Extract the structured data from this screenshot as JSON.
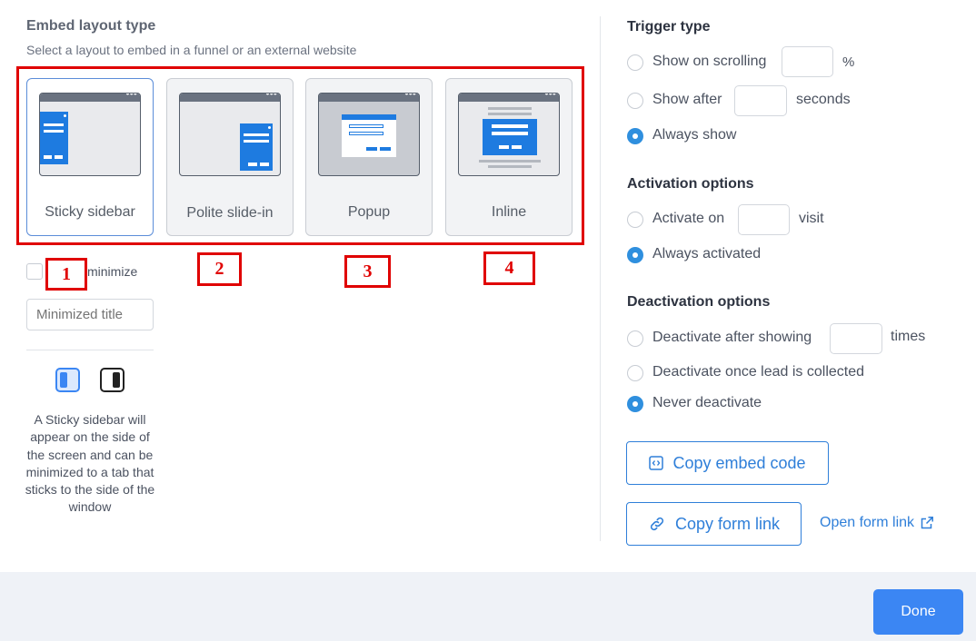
{
  "embed": {
    "title": "Embed layout type",
    "subtitle": "Select a layout to embed in a funnel or an external website",
    "layouts": [
      {
        "label": "Sticky sidebar"
      },
      {
        "label": "Polite slide-in"
      },
      {
        "label": "Popup"
      },
      {
        "label": "Inline"
      }
    ],
    "minimize_label": "minimize",
    "minimized_title_placeholder": "Minimized title",
    "description": "A Sticky sidebar will appear on the side of the screen and can be minimized to a tab that sticks to the side of the window"
  },
  "annotations": [
    "1",
    "2",
    "3",
    "4"
  ],
  "trigger": {
    "title": "Trigger type",
    "scrolling_label": "Show on scrolling",
    "scrolling_unit": "%",
    "after_label": "Show after",
    "after_unit": "seconds",
    "always_label": "Always show"
  },
  "activation": {
    "title": "Activation options",
    "activate_on_label": "Activate on",
    "activate_on_unit": "visit",
    "always_label": "Always activated"
  },
  "deactivation": {
    "title": "Deactivation options",
    "after_label": "Deactivate after showing",
    "after_unit": "times",
    "lead_label": "Deactivate once lead is collected",
    "never_label": "Never deactivate"
  },
  "actions": {
    "copy_embed": "Copy embed code",
    "copy_link": "Copy form link",
    "open_link": "Open form link",
    "done": "Done"
  },
  "colors": {
    "accent": "#2f7fd9",
    "annotation": "#e00000",
    "done_button": "#3b86f3"
  }
}
